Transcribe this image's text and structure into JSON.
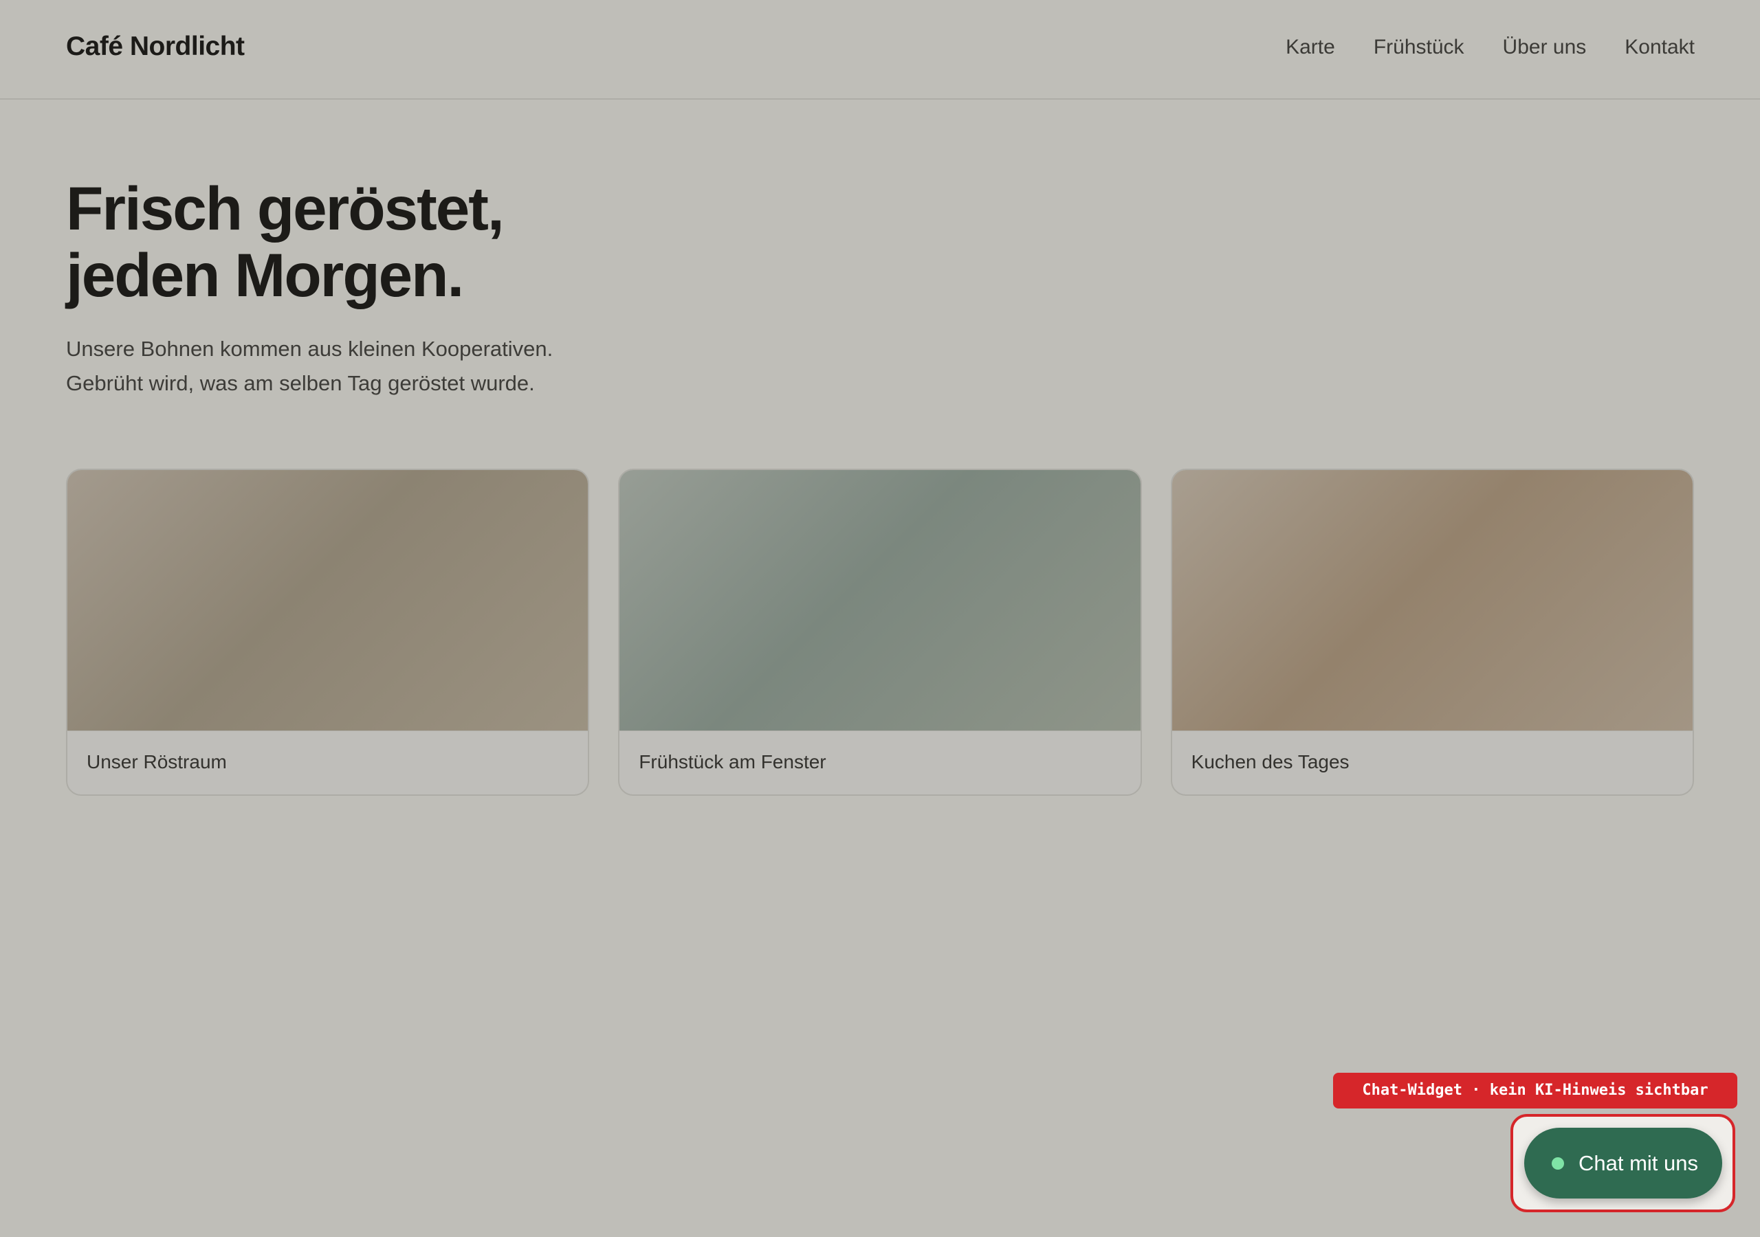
{
  "header": {
    "brand": "Café Nordlicht",
    "nav": [
      "Karte",
      "Frühstück",
      "Über uns",
      "Kontakt"
    ]
  },
  "hero": {
    "title_lines": [
      "Frisch geröstet,",
      "jeden Morgen."
    ],
    "subtitle_lines": [
      "Unsere Bohnen kommen aus kleinen Kooperativen.",
      "Gebrüht wird, was am selben Tag geröstet wurde."
    ]
  },
  "cards": [
    {
      "caption": "Unser Röstraum"
    },
    {
      "caption": "Frühstück am Fenster"
    },
    {
      "caption": "Kuchen des Tages"
    }
  ],
  "annotation": {
    "label": "Chat-Widget · kein KI-Hinweis sichtbar",
    "color": "#d6262a"
  },
  "chat_widget": {
    "label": "Chat mit uns",
    "button_color": "#2f6b51",
    "status_dot_color": "#7fe3a6",
    "icon": "online-status-dot-icon"
  }
}
